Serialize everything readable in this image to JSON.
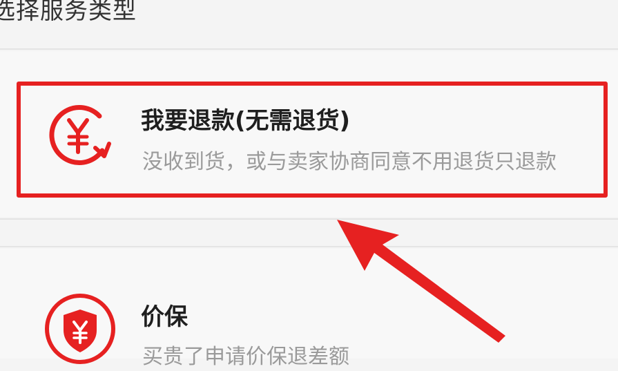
{
  "header": {
    "title": "选择服务类型"
  },
  "options": [
    {
      "title": "我要退款(无需退货)",
      "description": "没收到货，或与卖家协商同意不用退货只退款",
      "icon": "refund-yen-circle-arrow-icon",
      "highlighted": true
    },
    {
      "title": "价保",
      "description": "买贵了申请价保退差额",
      "icon": "yen-shield-icon",
      "highlighted": false
    }
  ],
  "colors": {
    "accent": "#e62121",
    "title_text": "#1f1f1f",
    "description_text": "#9a9a9a",
    "background": "#f4f4f4",
    "card_background": "#f8f8f8",
    "divider": "#e4e4e4"
  },
  "annotation": {
    "icon": "red-arrow-icon"
  }
}
